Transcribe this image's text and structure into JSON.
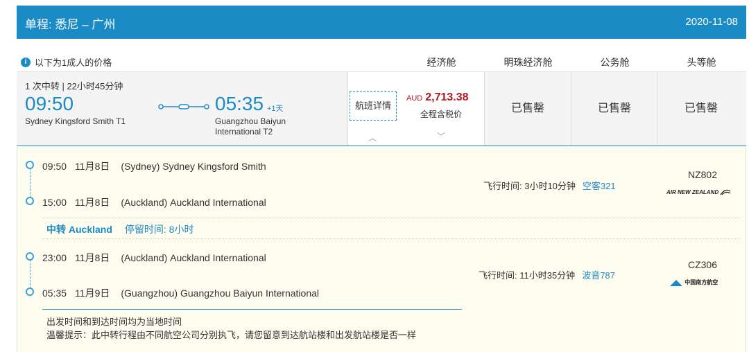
{
  "header": {
    "title": "单程:  悉尼  –  广州",
    "date": "2020-11-08"
  },
  "pricebar": {
    "note": "以下为1成人的价格",
    "cabins": [
      "经济舱",
      "明珠经济舱",
      "公务舱",
      "头等舱"
    ]
  },
  "summary": {
    "stops": "1 次中转  |  22小时45分钟",
    "departure": {
      "time": "09:50",
      "airport": "Sydney Kingsford Smith T1"
    },
    "arrival": {
      "time": "05:35",
      "day_offset": "+1天",
      "airport": "Guangzhou Baiyun International T2"
    },
    "detail_button": "航班详情",
    "economy": {
      "currency": "AUD",
      "price": "2,713.38",
      "tax_note": "全程含税价"
    },
    "premium_economy": "已售罄",
    "business": "已售罄",
    "first": "已售罄"
  },
  "segments": [
    {
      "dep": {
        "time": "09:50",
        "date": "11月8日",
        "airport": "(Sydney) Sydney Kingsford Smith"
      },
      "arr": {
        "time": "15:00",
        "date": "11月8日",
        "airport": "(Auckland) Auckland International"
      },
      "duration": "飞行时间: 3小时10分钟",
      "aircraft": "空客321",
      "flight_no": "NZ802",
      "airline": "AIR NEW ZEALAND"
    },
    {
      "dep": {
        "time": "23:00",
        "date": "11月8日",
        "airport": "(Auckland) Auckland International"
      },
      "arr": {
        "time": "05:35",
        "date": "11月9日",
        "airport": "(Guangzhou) Guangzhou Baiyun International"
      },
      "duration": "飞行时间: 11小时35分钟",
      "aircraft": "波音787",
      "flight_no": "CZ306",
      "airline": "中国南方航空"
    }
  ],
  "transfer": {
    "label": "中转 Auckland",
    "layover": "停留时间: 8小时"
  },
  "notes": [
    "出发时间和到达时间均为当地时间",
    "温馨提示：此中转行程由不同航空公司分别执飞，请您留意到达航站楼和出发航站楼是否一样"
  ],
  "colors": {
    "brand": "#1a8bc5",
    "price": "#b0171f",
    "detail_bg": "#fdfcee"
  }
}
